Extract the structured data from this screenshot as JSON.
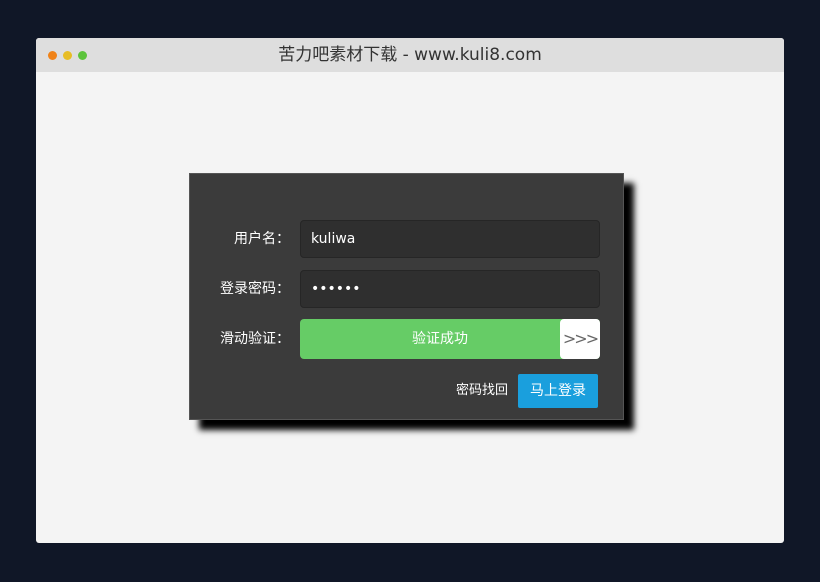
{
  "window": {
    "title": "苦力吧素材下载 - www.kuli8.com"
  },
  "form": {
    "username_label": "用户名：",
    "username_value": "kuliwa",
    "password_label": "登录密码：",
    "password_value": "••••••",
    "slider_label": "滑动验证：",
    "slider_text": "验证成功",
    "slider_handle": ">>>",
    "forgot_link": "密码找回",
    "login_button": "马上登录"
  },
  "colors": {
    "background": "#101727",
    "panel": "#3b3b3b",
    "success": "#66cc66",
    "accent": "#1a9fdd"
  }
}
